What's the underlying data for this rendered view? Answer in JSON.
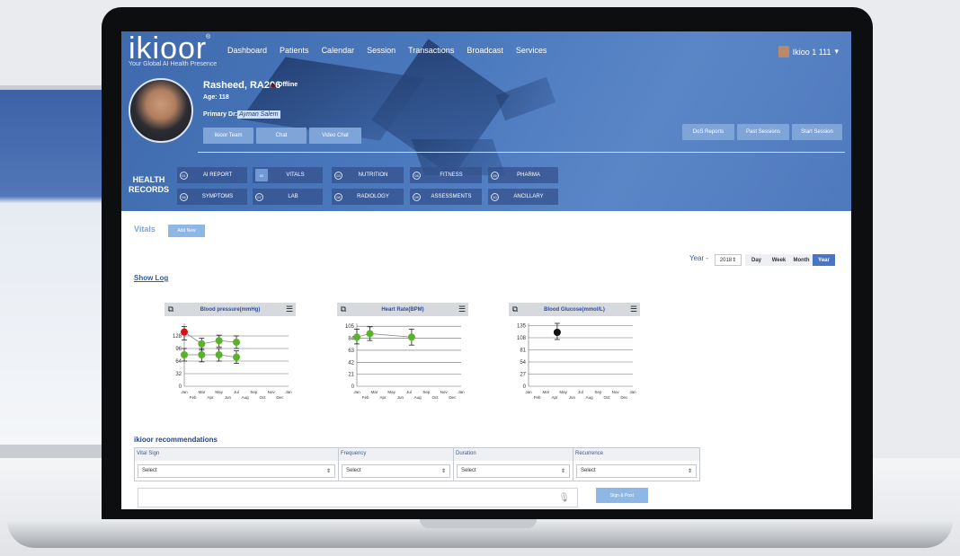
{
  "header": {
    "logo": "ikioor",
    "logo_mark": "®",
    "tagline": "Your Global AI Health Presence",
    "nav": [
      "Dashboard",
      "Patients",
      "Calendar",
      "Session",
      "Transactions",
      "Broadcast",
      "Services"
    ],
    "user": "Ikioo 1 111",
    "user_caret": "▾"
  },
  "patient": {
    "name": "Rasheed, RA206",
    "status": "Offline",
    "age": "Age: 118",
    "primary_label": "Primary Dr:",
    "primary_dr": "Ayman Salem",
    "actions": [
      "Ikioor Team",
      "Chat",
      "Video Chat"
    ],
    "right_actions": [
      "DoS Reports",
      "Past Sessions",
      "Start Session"
    ]
  },
  "health_records": {
    "label_line1": "HEALTH",
    "label_line2": "RECORDS",
    "row1": [
      {
        "num": "01",
        "label": "AI REPORT"
      },
      {
        "num": "02",
        "label": "VITALS"
      },
      {
        "num": "03",
        "label": "NUTRITION"
      },
      {
        "num": "04",
        "label": "FITNESS"
      },
      {
        "num": "05",
        "label": "PHARMA"
      }
    ],
    "row2": [
      {
        "num": "06",
        "label": "SYMPTOMS"
      },
      {
        "num": "07",
        "label": "LAB"
      },
      {
        "num": "08",
        "label": "RADIOLOGY"
      },
      {
        "num": "09",
        "label": "ASSESSMENTS"
      },
      {
        "num": "10",
        "label": "ANCILLARY"
      }
    ]
  },
  "vitals": {
    "title": "Vitals",
    "add_new": "Add New",
    "year_label": "Year -",
    "year_value": "2018",
    "periods": [
      "Day",
      "Week",
      "Month",
      "Year"
    ],
    "active_period": "Year",
    "show_log": "Show Log"
  },
  "chart_data": [
    {
      "type": "scatter",
      "title": "Blood pressure(mmHg)",
      "yticks": [
        0,
        32,
        64,
        96,
        128
      ],
      "ylim": [
        0,
        160
      ],
      "xticks_top": [
        "Jan",
        "Mar",
        "May",
        "Jul",
        "Sep",
        "Nov",
        "Jan"
      ],
      "xticks_bottom": [
        "Feb",
        "Apr",
        "Jun",
        "Aug",
        "Oct",
        "Dec"
      ],
      "series": [
        {
          "points": [
            {
              "m": 0,
              "y": 138,
              "lo": 118,
              "hi": 152,
              "c": "#d21414"
            },
            {
              "m": 2,
              "y": 108,
              "lo": 92,
              "hi": 122,
              "c": "#5ab12a"
            },
            {
              "m": 4,
              "y": 116,
              "lo": 100,
              "hi": 130,
              "c": "#5ab12a"
            },
            {
              "m": 6,
              "y": 112,
              "lo": 96,
              "hi": 128,
              "c": "#5ab12a"
            }
          ]
        },
        {
          "points": [
            {
              "m": 0,
              "y": 80,
              "lo": 64,
              "hi": 96,
              "c": "#5ab12a"
            },
            {
              "m": 2,
              "y": 80,
              "lo": 62,
              "hi": 96,
              "c": "#5ab12a"
            },
            {
              "m": 4,
              "y": 80,
              "lo": 64,
              "hi": 96,
              "c": "#5ab12a"
            },
            {
              "m": 6,
              "y": 74,
              "lo": 58,
              "hi": 90,
              "c": "#5ab12a"
            }
          ]
        }
      ]
    },
    {
      "type": "scatter",
      "title": "Heart Rate(BPM)",
      "yticks": [
        0,
        21,
        42,
        63,
        84,
        105
      ],
      "ylim": [
        0,
        110
      ],
      "xticks_top": [
        "Jan",
        "Mar",
        "May",
        "Jul",
        "Sep",
        "Nov",
        "Jan"
      ],
      "xticks_bottom": [
        "Feb",
        "Apr",
        "Jun",
        "Aug",
        "Oct",
        "Dec"
      ],
      "series": [
        {
          "points": [
            {
              "m": 0,
              "y": 86,
              "lo": 74,
              "hi": 100,
              "c": "#5ab12a"
            },
            {
              "m": 1.5,
              "y": 92,
              "lo": 80,
              "hi": 104,
              "c": "#5ab12a"
            },
            {
              "m": 6.3,
              "y": 86,
              "lo": 72,
              "hi": 100,
              "c": "#5ab12a"
            }
          ]
        }
      ]
    },
    {
      "type": "scatter",
      "title": "Blood Glucose(mmol/L)",
      "yticks": [
        0,
        27,
        54,
        81,
        108,
        135
      ],
      "ylim": [
        0,
        140
      ],
      "xticks_top": [
        "Jan",
        "Mar",
        "May",
        "Jul",
        "Sep",
        "Nov",
        "Jan"
      ],
      "xticks_bottom": [
        "Feb",
        "Apr",
        "Jun",
        "Aug",
        "Oct",
        "Dec"
      ],
      "series": [
        {
          "points": [
            {
              "m": 3.3,
              "y": 120,
              "lo": 104,
              "hi": 140,
              "c": "#111111"
            }
          ]
        }
      ]
    }
  ],
  "recommendations": {
    "title": "ikioor recommendations",
    "columns": [
      "Vital Sign",
      "Frequency",
      "Duration",
      "Recurrence"
    ],
    "select_placeholder": "Select",
    "select_caret": "⇕",
    "mic_icon": "🎙",
    "sign_post": "Sign & Post"
  }
}
